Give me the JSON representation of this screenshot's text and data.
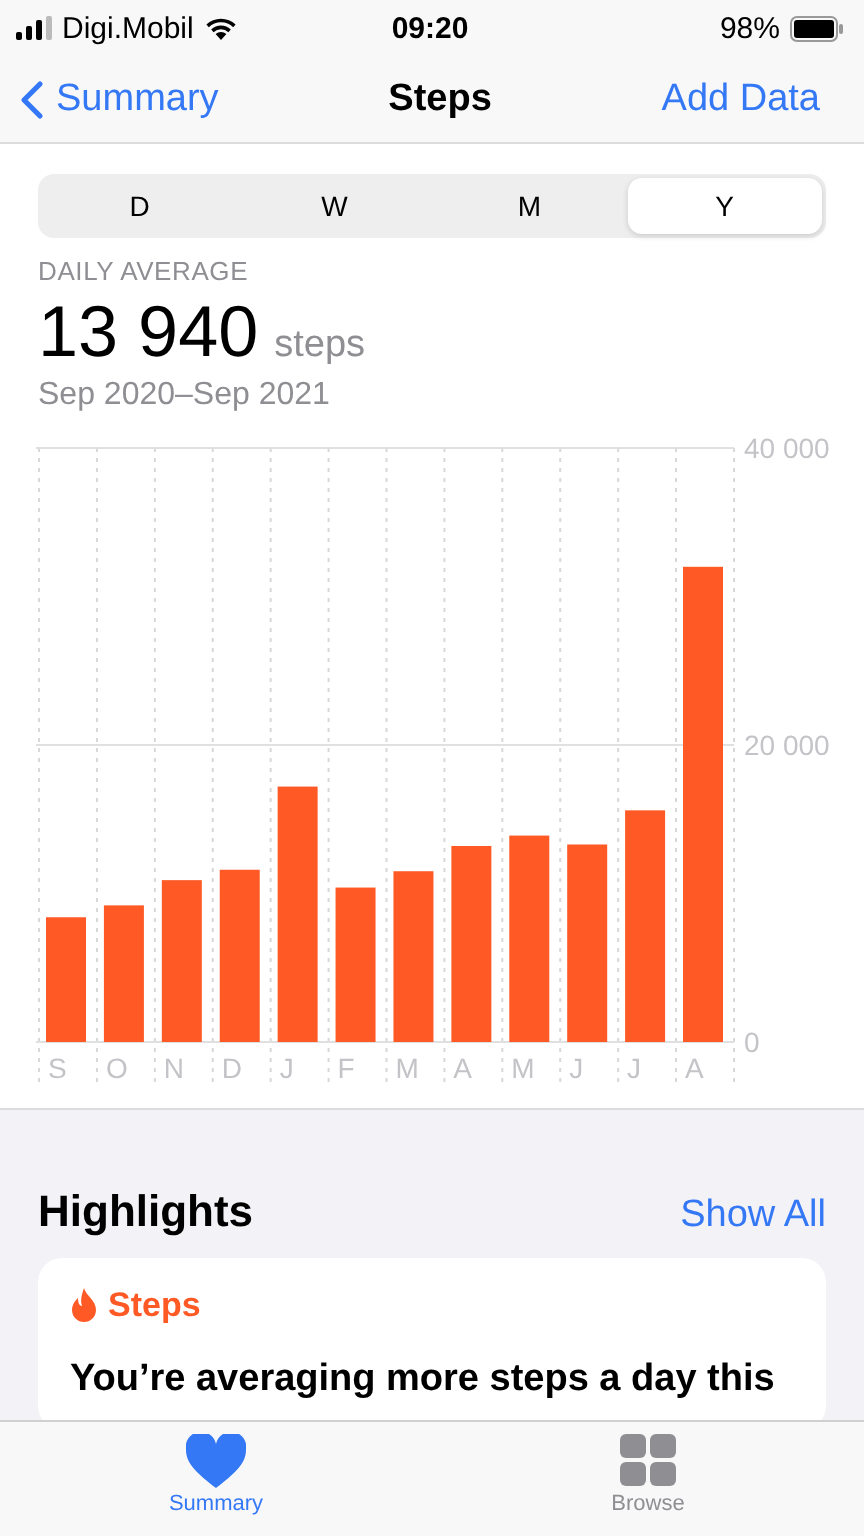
{
  "status_bar": {
    "carrier": "Digi.Mobil",
    "time": "09:20",
    "battery": "98%"
  },
  "nav": {
    "back": "Summary",
    "title": "Steps",
    "action": "Add Data"
  },
  "segments": [
    {
      "label": "D",
      "selected": false
    },
    {
      "label": "W",
      "selected": false
    },
    {
      "label": "M",
      "selected": false
    },
    {
      "label": "Y",
      "selected": true
    }
  ],
  "summary": {
    "caption": "DAILY AVERAGE",
    "value": "13 940",
    "unit": "steps",
    "range": "Sep 2020–Sep 2021"
  },
  "chart_data": {
    "type": "bar",
    "categories": [
      "S",
      "O",
      "N",
      "D",
      "J",
      "F",
      "M",
      "A",
      "M",
      "J",
      "J",
      "A"
    ],
    "values": [
      8400,
      9200,
      10900,
      11600,
      17200,
      10400,
      11500,
      13200,
      13900,
      13300,
      15600,
      32000
    ],
    "ylim": [
      0,
      40000
    ],
    "yticks": [
      {
        "value": 0,
        "label": "0"
      },
      {
        "value": 20000,
        "label": "20 000"
      },
      {
        "value": 40000,
        "label": "40 000"
      }
    ]
  },
  "highlights": {
    "title": "Highlights",
    "link": "Show All",
    "card": {
      "title": "Steps",
      "text": "You’re averaging more steps a day this"
    }
  },
  "tab_bar": [
    {
      "label": "Summary",
      "selected": true
    },
    {
      "label": "Browse",
      "selected": false
    }
  ]
}
